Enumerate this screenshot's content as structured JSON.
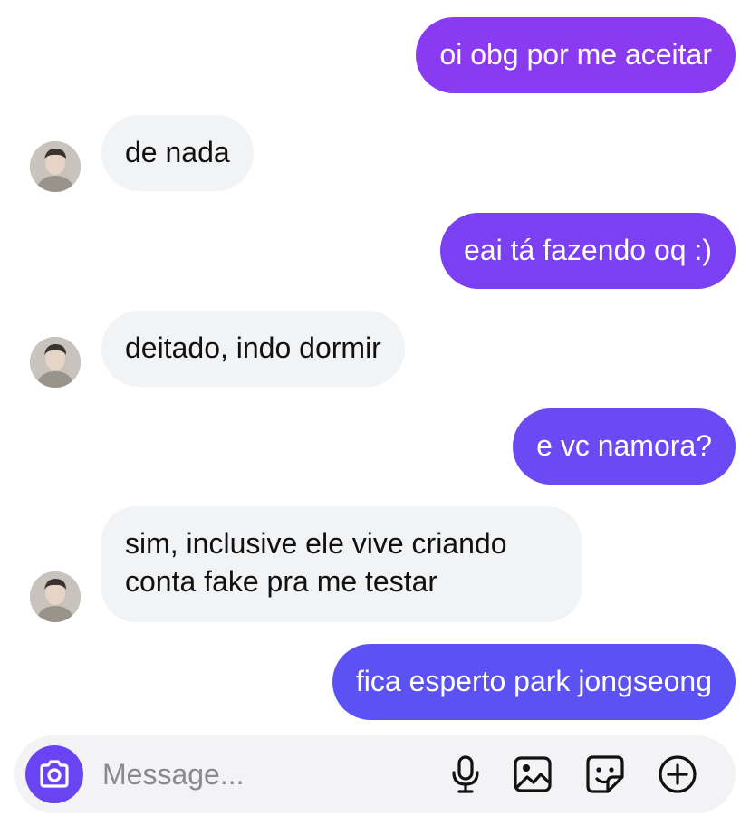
{
  "messages": [
    {
      "side": "out",
      "text": "oi obg por me aceitar"
    },
    {
      "side": "in",
      "text": "de nada"
    },
    {
      "side": "out",
      "text": "eai tá fazendo oq :)"
    },
    {
      "side": "in",
      "text": "deitado, indo dormir"
    },
    {
      "side": "out",
      "text": "e vc namora?"
    },
    {
      "side": "in",
      "lines": [
        "sim, inclusive ele vive criando",
        "conta fake pra me testar"
      ]
    },
    {
      "side": "out",
      "text": "fica esperto park jongseong"
    }
  ],
  "composer": {
    "placeholder": "Message...",
    "icons": [
      "camera-icon",
      "microphone-icon",
      "photo-icon",
      "sticker-icon",
      "plus-icon"
    ]
  },
  "colors": {
    "out_top": "#8a3af0",
    "out_mid": "#6f45f3",
    "out_bottom": "#5c52f3",
    "in_bubble": "#f2f3f5",
    "camera_button": "#6a44f2"
  }
}
